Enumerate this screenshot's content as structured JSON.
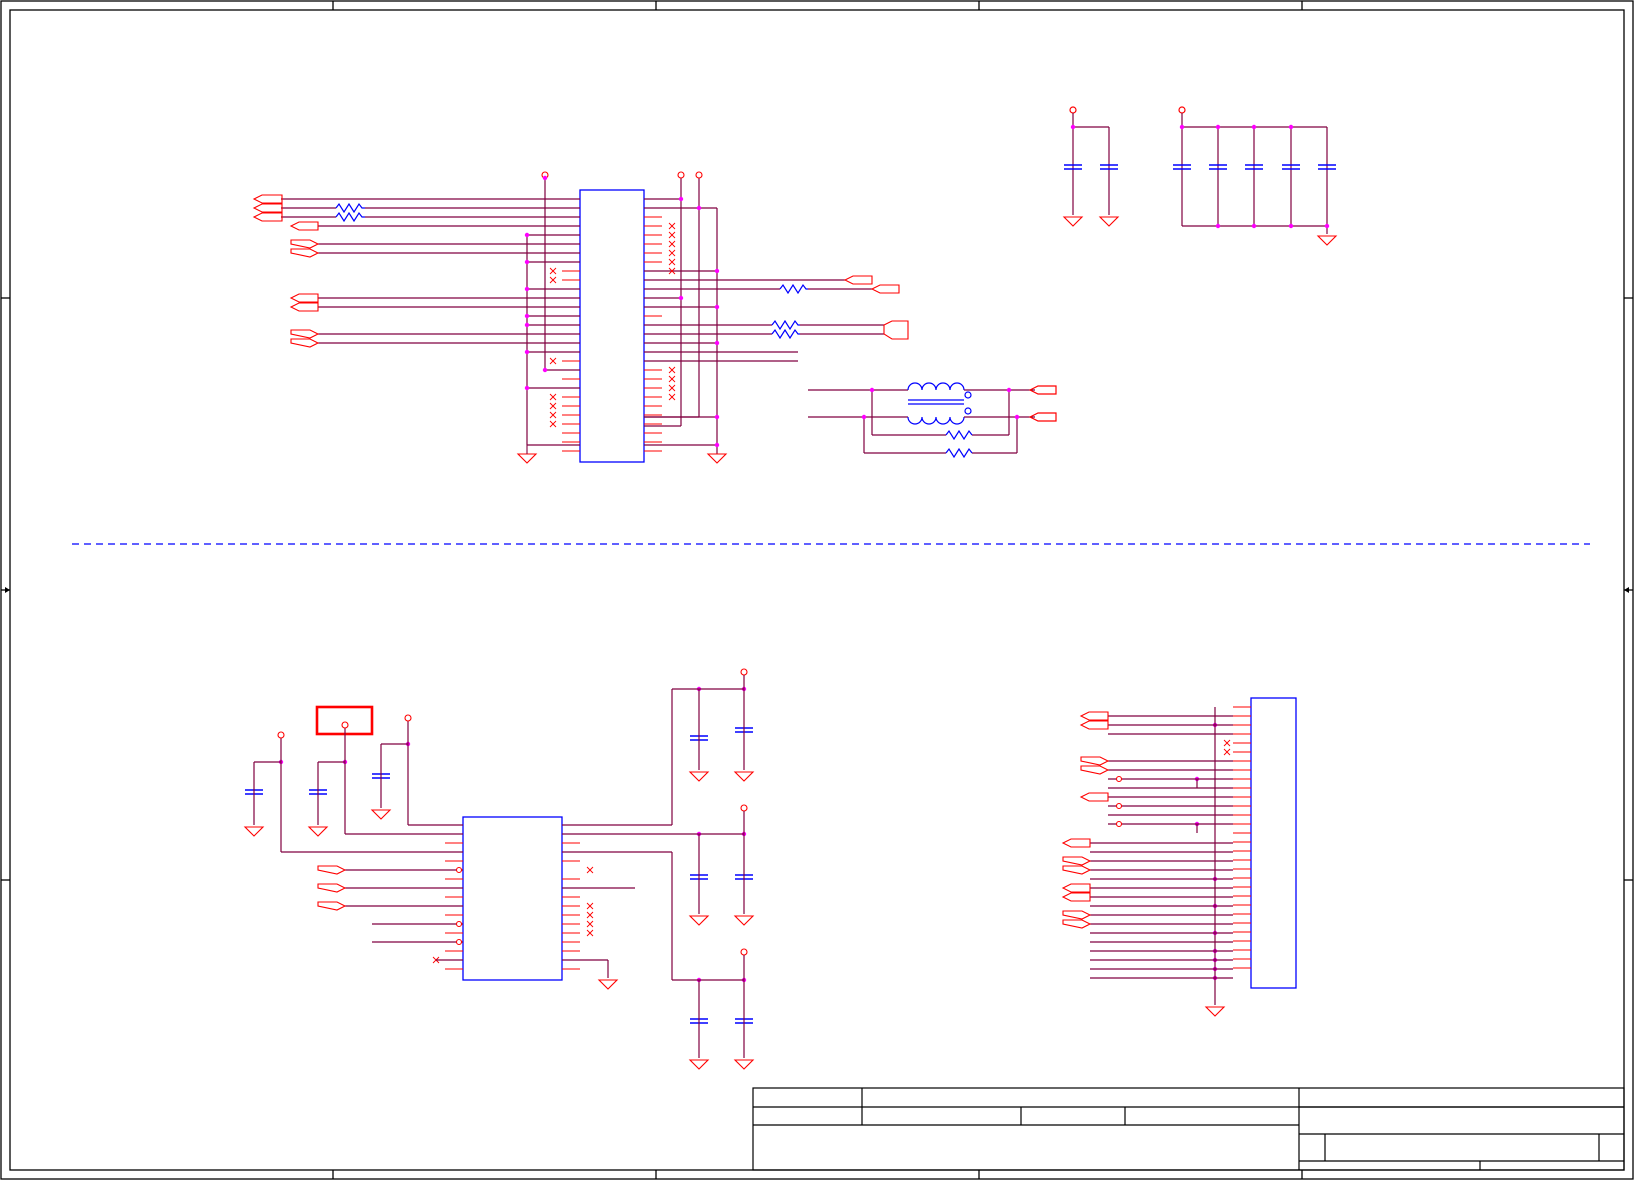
{
  "sheet": {
    "title_block": {
      "title": "",
      "size": "",
      "document_number": "",
      "revision": "",
      "date": "",
      "sheet": ""
    }
  },
  "colors": {
    "wire_red": "#ff0000",
    "wire_purple": "#800040",
    "wire_blue": "#0000ff",
    "junction": "#ff00ff",
    "component_blue": "#0000ff",
    "frame_black": "#000000",
    "divider_blue": "#0000ff",
    "highlight_box": "#ff0000"
  }
}
